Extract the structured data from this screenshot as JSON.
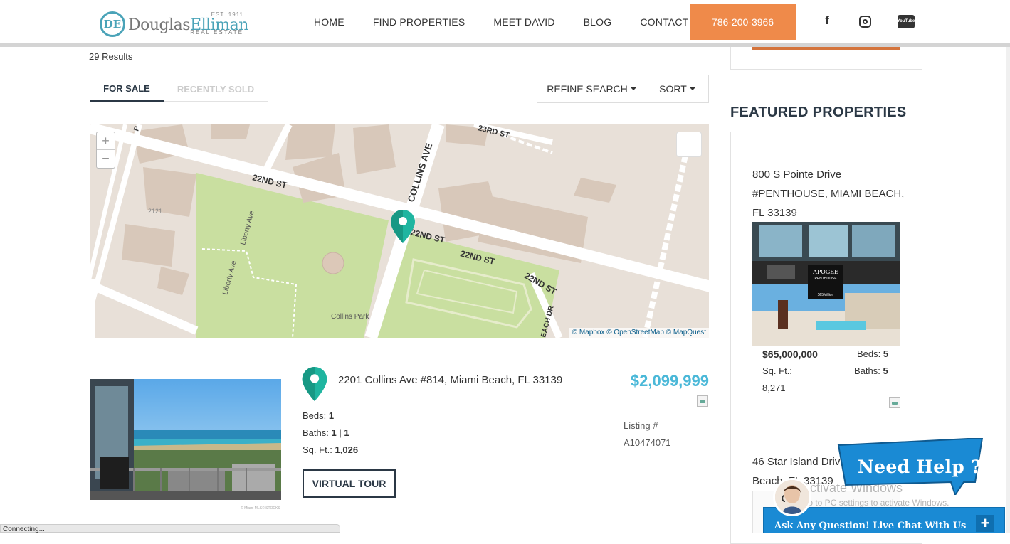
{
  "header": {
    "logo": {
      "est": "EST. 1911",
      "word_part1": "Douglas",
      "word_part2": "Elliman",
      "tagline": "REAL ESTATE",
      "mark": "DE"
    },
    "nav": [
      "HOME",
      "FIND PROPERTIES",
      "MEET DAVID",
      "BLOG",
      "CONTACT"
    ],
    "phone": "786-200-3966",
    "social": {
      "facebook": "f",
      "youtube_line1": "You",
      "youtube_line2": "Tube"
    }
  },
  "results_count": "29 Results",
  "tabs": {
    "for_sale": "FOR SALE",
    "recently_sold": "RECENTLY SOLD"
  },
  "controls": {
    "refine": "REFINE SEARCH",
    "sort": "SORT"
  },
  "map": {
    "zoom_in": "+",
    "zoom_out": "−",
    "labels": {
      "s22": "22ND ST",
      "s23": "23RD ST",
      "collins": "COLLINS AVE",
      "liberty": "Liberty Ave",
      "park": "Collins Park",
      "num": "2121",
      "beach": "EACH DR",
      "p": "P"
    },
    "attribution": "© Mapbox © OpenStreetMap © MapQuest"
  },
  "listing": {
    "address": "2201 Collins Ave #814, Miami Beach, FL 33139",
    "price": "$2,099,999",
    "beds_label": "Beds:",
    "beds": "1",
    "baths_label": "Baths:",
    "baths_full": "1",
    "baths_sep": "|",
    "baths_half": "1",
    "sqft_label": "Sq. Ft.:",
    "sqft": "1,026",
    "listing_label": "Listing #",
    "listing_number": "A10474071",
    "virtual_tour": "VIRTUAL TOUR",
    "watermark": "© Miami MLS© STOCKS"
  },
  "featured": {
    "title": "FEATURED PROPERTIES",
    "p1": {
      "address": "800 S Pointe Drive #PENTHOUSE, MIAMI BEACH, FL 33139",
      "price": "$65,000,000",
      "beds_label": "Beds:",
      "beds": "5",
      "sqft_label": "Sq. Ft.:",
      "sqft": "8,271",
      "baths_label": "Baths:",
      "baths": "5",
      "img_brand": "APOGEE",
      "img_sub": "PENTHOUSE",
      "img_price": "$65Million"
    },
    "p2": {
      "address": "46 Star Island Drive, Miami Beach, FL 33139"
    }
  },
  "chat": {
    "bubble": "Need Help ?",
    "bar": "Ask Any Question! Live Chat With Us",
    "plus": "+"
  },
  "windows": {
    "line1": "Activate Windows",
    "line2": "Go to PC settings to activate Windows."
  },
  "status": "Connecting...",
  "colors": {
    "accent_orange": "#ef8a4a",
    "price_blue": "#4ab8d8",
    "pin_teal": "#1fb5a0",
    "navy": "#2b3845",
    "chat_blue": "#1a8ad4"
  }
}
